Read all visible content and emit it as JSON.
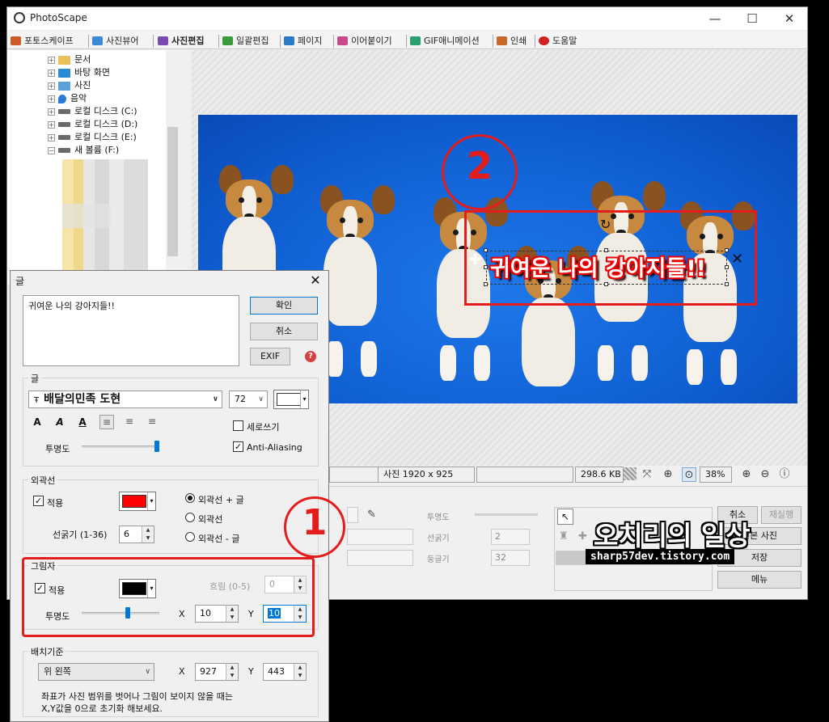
{
  "window": {
    "title": "PhotoScape",
    "controls": {
      "minimize": "—",
      "maximize": "☐",
      "close": "✕"
    }
  },
  "tabs": [
    {
      "label": "포토스케이프",
      "color": "#d05a2a"
    },
    {
      "label": "사진뷰어",
      "color": "#3b8ad6"
    },
    {
      "label": "사진편집",
      "color": "#7a4ab0",
      "active": true
    },
    {
      "label": "일괄편집",
      "color": "#3b9a3b"
    },
    {
      "label": "페이지",
      "color": "#2a7ac8"
    },
    {
      "label": "이어붙이기",
      "color": "#c84a8a"
    },
    {
      "label": "GIF애니메이션",
      "color": "#2aa070"
    },
    {
      "label": "인쇄",
      "color": "#c86a2a"
    },
    {
      "label": "도움말",
      "color": "#d02020"
    }
  ],
  "tree": [
    {
      "label": "문서",
      "icon": "folder-icon",
      "color": "#e8c15a"
    },
    {
      "label": "바탕 화면",
      "icon": "desktop-icon",
      "color": "#2a8ad6"
    },
    {
      "label": "사진",
      "icon": "pictures-icon",
      "color": "#5aa0d6"
    },
    {
      "label": "음악",
      "icon": "music-icon",
      "color": "#2a7ad6"
    },
    {
      "label": "로컬 디스크 (C:)",
      "icon": "drive-c-icon",
      "color": "#6a6a6a"
    },
    {
      "label": "로컬 디스크 (D:)",
      "icon": "drive-d-icon",
      "color": "#6a6a6a"
    },
    {
      "label": "로컬 디스크 (E:)",
      "icon": "drive-e-icon",
      "color": "#6a6a6a"
    },
    {
      "label": "새 볼륨 (F:)",
      "icon": "drive-f-icon",
      "color": "#6a6a6a"
    }
  ],
  "canvas": {
    "text_object": "귀여운 나의 강아지들!!",
    "callout_number": "2"
  },
  "status": {
    "image_size": "사진 1920 x 925",
    "file_size": "298.6 KB",
    "zoom": "38%"
  },
  "bottom_panel": {
    "opacity_label": "투명도",
    "stroke_label": "선굵기",
    "stroke_value": "2",
    "round_label": "둥글기",
    "round_value": "32",
    "cancel": "취소",
    "redo": "재실행",
    "original": "원본 사진",
    "save": "저장",
    "menu": "메뉴"
  },
  "watermark": {
    "line1": "오치리의 일상",
    "line2": "sharp57dev.tistory.com"
  },
  "dialog": {
    "title": "글",
    "text_value": "귀여운 나의 강아지들!!",
    "ok": "확인",
    "cancel": "취소",
    "exif": "EXIF",
    "text_group": {
      "legend": "글",
      "font": "배달의민족 도현",
      "size": "72",
      "color": "#ffffff",
      "vertical": "세로쓰기",
      "vertical_checked": false,
      "antialias": "Anti-Aliasing",
      "antialias_checked": true,
      "opacity_label": "투명도",
      "opacity_level": 1.0
    },
    "outline_group": {
      "legend": "외곽선",
      "apply": "적용",
      "apply_checked": true,
      "color": "#ff0000",
      "width_label": "선굵기 (1-36)",
      "width_value": "6",
      "radio_options": [
        "외곽선 + 글",
        "외곽선",
        "외곽선 - 글"
      ],
      "selected": 0
    },
    "shadow_group": {
      "legend": "그림자",
      "apply": "적용",
      "apply_checked": true,
      "color": "#000000",
      "blur_label": "흐림 (0-5)",
      "blur_value": "0",
      "opacity_label": "투명도",
      "opacity_level": 0.6,
      "x_label": "X",
      "x_value": "10",
      "y_label": "Y",
      "y_value": "10"
    },
    "position_group": {
      "legend": "배치기준",
      "anchor": "위 왼쪽",
      "x_label": "X",
      "x_value": "927",
      "y_label": "Y",
      "y_value": "443",
      "note_line1": "좌표가 사진 범위를 벗어나 그림이 보이지 않을 때는",
      "note_line2": "X,Y값을 0으로 초기화 해보세요."
    },
    "callout_number": "1"
  }
}
